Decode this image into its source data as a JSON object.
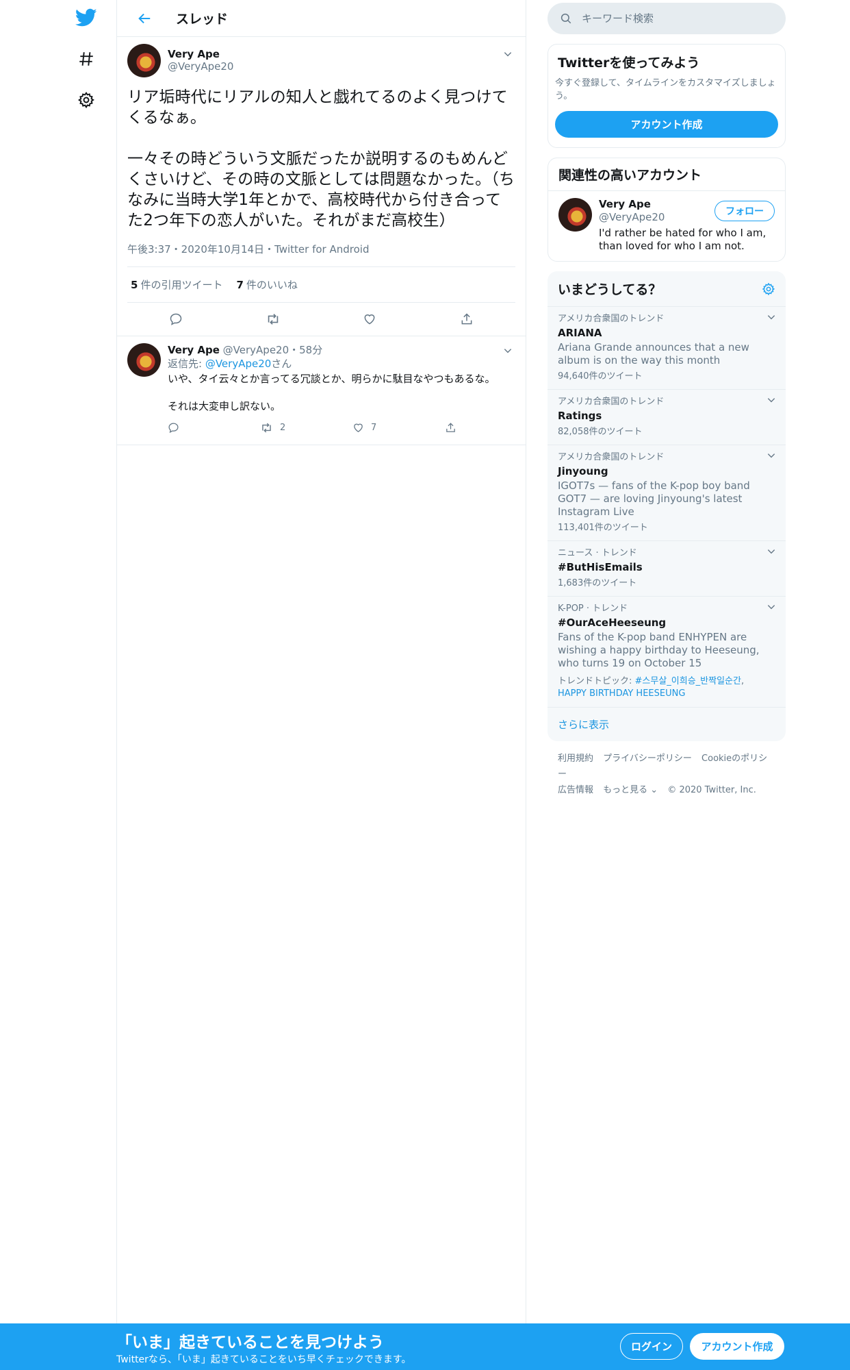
{
  "header": {
    "title": "スレッド"
  },
  "focal_tweet": {
    "author_name": "Very Ape",
    "author_handle": "@VeryApe20",
    "text": "リア垢時代にリアルの知人と戯れてるのよく見つけてくるなぁ。\n\n一々その時どういう文脈だったか説明するのもめんどくさいけど、その時の文脈としては問題なかった。（ちなみに当時大学1年とかで、高校時代から付き合ってた2つ年下の恋人がいた。それがまだ高校生）",
    "meta": "午後3:37・2020年10月14日・Twitter for Android",
    "quote_count": "5",
    "quote_label": "件の引用ツイート",
    "like_count": "7",
    "like_label": "件のいいね"
  },
  "reply": {
    "author_name": "Very Ape",
    "author_handle": "@VeryApe20",
    "time": "・58分",
    "replying_prefix": "返信先: ",
    "replying_to": "@VeryApe20",
    "replying_suffix": "さん",
    "text": "いや、タイ云々とか言ってる冗談とか、明らかに駄目なやつもあるな。\n\nそれは大変申し訳ない。",
    "retweet_count": "2",
    "like_count": "7"
  },
  "search": {
    "placeholder": "キーワード検索"
  },
  "signup_card": {
    "title": "Twitterを使ってみよう",
    "description": "今すぐ登録して、タイムラインをカスタマイズしましょう。",
    "button": "アカウント作成"
  },
  "related": {
    "title": "関連性の高いアカウント",
    "name": "Very Ape",
    "handle": "@VeryApe20",
    "bio": "I'd rather be hated for who I am, than loved for who I am not.",
    "follow_label": "フォロー"
  },
  "trends": {
    "title": "いまどうしてる？",
    "items": [
      {
        "context": "アメリカ合衆国のトレンド",
        "name": "ARIANA",
        "description": "Ariana Grande announces that a new album is on the way this month",
        "count": "94,640件のツイート"
      },
      {
        "context": "アメリカ合衆国のトレンド",
        "name": "Ratings",
        "description": "",
        "count": "82,058件のツイート"
      },
      {
        "context": "アメリカ合衆国のトレンド",
        "name": "Jinyoung",
        "description": "IGOT7s — fans of the K-pop boy band GOT7 — are loving Jinyoung's latest Instagram Live",
        "count": "113,401件のツイート"
      },
      {
        "context": "ニュース · トレンド",
        "name": "#ButHisEmails",
        "description": "",
        "count": "1,683件のツイート"
      },
      {
        "context": "K-POP · トレンド",
        "name": "#OurAceHeeseung",
        "description": "Fans of the K-pop band ENHYPEN are wishing a happy birthday to Heeseung, who turns 19 on October 15",
        "count": ""
      }
    ],
    "topics_prefix": "トレンドトピック: ",
    "topic_1": "#스무살_이희승_반짝일순간",
    "topic_sep": ", ",
    "topic_2": "HAPPY BIRTHDAY HEESEUNG",
    "more": "さらに表示"
  },
  "footer": {
    "terms": "利用規約",
    "privacy": "プライバシーポリシー",
    "cookies": "Cookieのポリシー",
    "ads": "広告情報",
    "more": "もっと見る ⌄",
    "copyright": "© 2020 Twitter, Inc."
  },
  "bottom_bar": {
    "title": "「いま」起きていることを見つけよう",
    "subtitle": "Twitterなら、「いま」起きていることをいち早くチェックできます。",
    "login": "ログイン",
    "signup": "アカウント作成"
  },
  "colors": {
    "accent": "#1da1f2",
    "link": "#1b95e0",
    "muted": "#657786",
    "border": "#e6ecf0"
  }
}
